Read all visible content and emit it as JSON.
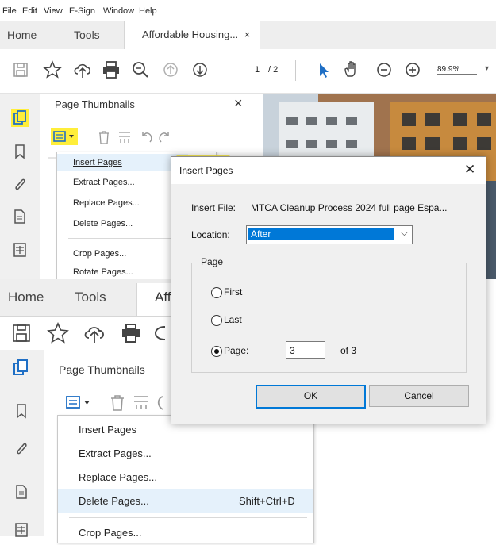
{
  "menubar": [
    "File",
    "Edit",
    "View",
    "E-Sign",
    "Window",
    "Help"
  ],
  "tabs": {
    "home": "Home",
    "tools": "Tools",
    "doc": "Affordable Housing...",
    "doc_close": "×",
    "doc_partial": "Affo"
  },
  "toolbar": {
    "page_current": "1",
    "page_total": "/ 2",
    "zoom": "89.9%"
  },
  "panel": {
    "title": "Page Thumbnails",
    "close": "×",
    "menu_items": [
      "Insert Pages",
      "Extract Pages...",
      "Replace Pages...",
      "Delete Pages...",
      "Crop Pages...",
      "Rotate Pages..."
    ]
  },
  "panel2": {
    "title": "Page Thumbnails",
    "menu_items": [
      "Insert Pages",
      "Extract Pages...",
      "Replace Pages...",
      "Delete Pages...",
      "Crop Pages..."
    ],
    "delete_shortcut": "Shift+Ctrl+D"
  },
  "dialog": {
    "title": "Insert Pages",
    "close": "✕",
    "insert_file_label": "Insert File:",
    "insert_file_value": "MTCA Cleanup Process 2024 full page Espa...",
    "location_label": "Location:",
    "location_value": "After",
    "page_group": "Page",
    "first": "First",
    "last": "Last",
    "page_label": "Page:",
    "page_value": "3",
    "of_total": "of 3",
    "ok": "OK",
    "cancel": "Cancel"
  },
  "colors": {
    "highlight": "#ffee3a",
    "accent": "#0078d7",
    "thumb_icon": "#e0a800"
  }
}
